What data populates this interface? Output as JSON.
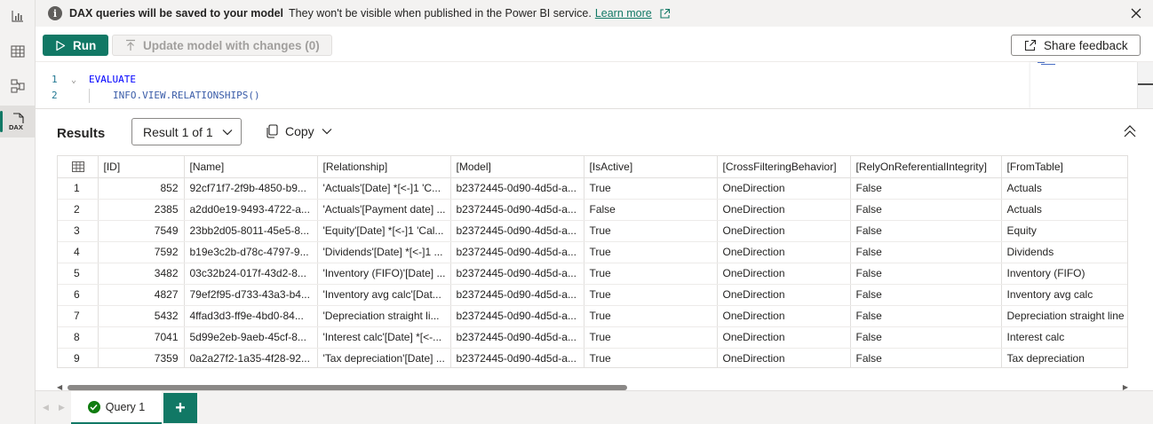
{
  "rail": {
    "items": [
      {
        "icon": "report-view-icon"
      },
      {
        "icon": "table-view-icon"
      },
      {
        "icon": "model-view-icon"
      },
      {
        "icon": "dax-query-view-icon",
        "label": "DAX",
        "active": true
      }
    ]
  },
  "infobar": {
    "title": "DAX queries will be saved to your model",
    "text": "They won't be visible when published in the Power BI service.",
    "link": "Learn more"
  },
  "toolbar": {
    "run_label": "Run",
    "update_label": "Update model with changes (0)",
    "feedback_label": "Share feedback"
  },
  "editor": {
    "lines": [
      {
        "number": "1",
        "text": "EVALUATE"
      },
      {
        "number": "2",
        "text": "INFO.VIEW.RELATIONSHIPS()"
      }
    ]
  },
  "results": {
    "title": "Results",
    "result_selector": "Result 1 of 1",
    "copy_label": "Copy",
    "columns": [
      "[ID]",
      "[Name]",
      "[Relationship]",
      "[Model]",
      "[IsActive]",
      "[CrossFilteringBehavior]",
      "[RelyOnReferentialIntegrity]",
      "[FromTable]"
    ],
    "rows": [
      {
        "n": "1",
        "cells": [
          "852",
          "92cf71f7-2f9b-4850-b9...",
          "'Actuals'[Date] *[<-]1 'C...",
          "b2372445-0d90-4d5d-a...",
          "True",
          "OneDirection",
          "False",
          "Actuals"
        ]
      },
      {
        "n": "2",
        "cells": [
          "2385",
          "a2dd0e19-9493-4722-a...",
          "'Actuals'[Payment date] ...",
          "b2372445-0d90-4d5d-a...",
          "False",
          "OneDirection",
          "False",
          "Actuals"
        ]
      },
      {
        "n": "3",
        "cells": [
          "7549",
          "23bb2d05-8011-45e5-8...",
          "'Equity'[Date] *[<-]1 'Cal...",
          "b2372445-0d90-4d5d-a...",
          "True",
          "OneDirection",
          "False",
          "Equity"
        ]
      },
      {
        "n": "4",
        "cells": [
          "7592",
          "b19e3c2b-d78c-4797-9...",
          "'Dividends'[Date] *[<-]1 ...",
          "b2372445-0d90-4d5d-a...",
          "True",
          "OneDirection",
          "False",
          "Dividends"
        ]
      },
      {
        "n": "5",
        "cells": [
          "3482",
          "03c32b24-017f-43d2-8...",
          "'Inventory (FIFO)'[Date] ...",
          "b2372445-0d90-4d5d-a...",
          "True",
          "OneDirection",
          "False",
          "Inventory (FIFO)"
        ]
      },
      {
        "n": "6",
        "cells": [
          "4827",
          "79ef2f95-d733-43a3-b4...",
          "'Inventory avg calc'[Dat...",
          "b2372445-0d90-4d5d-a...",
          "True",
          "OneDirection",
          "False",
          "Inventory avg calc"
        ]
      },
      {
        "n": "7",
        "cells": [
          "5432",
          "4ffad3d3-ff9e-4bd0-84...",
          "'Depreciation straight li...",
          "b2372445-0d90-4d5d-a...",
          "True",
          "OneDirection",
          "False",
          "Depreciation straight line"
        ]
      },
      {
        "n": "8",
        "cells": [
          "7041",
          "5d99e2eb-9aeb-45cf-8...",
          "'Interest calc'[Date] *[<-...",
          "b2372445-0d90-4d5d-a...",
          "True",
          "OneDirection",
          "False",
          "Interest calc"
        ]
      },
      {
        "n": "9",
        "cells": [
          "7359",
          "0a2a27f2-1a35-4f28-92...",
          "'Tax depreciation'[Date] ...",
          "b2372445-0d90-4d5d-a...",
          "True",
          "OneDirection",
          "False",
          "Tax depreciation"
        ]
      }
    ]
  },
  "tabs": {
    "items": [
      {
        "label": "Query 1",
        "status": "success"
      }
    ],
    "add_label": "+"
  },
  "colors": {
    "accent": "#117865",
    "success": "#107c10"
  }
}
